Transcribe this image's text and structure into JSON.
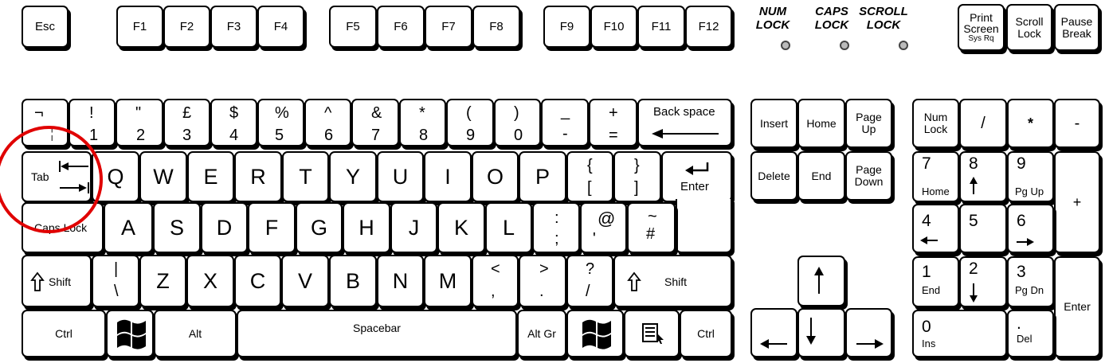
{
  "function_row": {
    "esc": "Esc",
    "f": [
      "F1",
      "F2",
      "F3",
      "F4",
      "F5",
      "F6",
      "F7",
      "F8",
      "F9",
      "F10",
      "F11",
      "F12"
    ]
  },
  "lock_lights": {
    "num": [
      "NUM",
      "LOCK"
    ],
    "caps": [
      "CAPS",
      "LOCK"
    ],
    "scroll": [
      "SCROLL",
      "LOCK"
    ]
  },
  "system_keys": {
    "print": [
      "Print",
      "Screen",
      "Sys Rq"
    ],
    "scroll": [
      "Scroll",
      "Lock"
    ],
    "pause": [
      "Pause",
      "Break"
    ]
  },
  "number_row": [
    {
      "top": "¬",
      "bot": "¦"
    },
    {
      "top": "!",
      "bot": "1"
    },
    {
      "top": "\"",
      "bot": "2"
    },
    {
      "top": "£",
      "bot": "3"
    },
    {
      "top": "$",
      "bot": "4"
    },
    {
      "top": "%",
      "bot": "5"
    },
    {
      "top": "^",
      "bot": "6"
    },
    {
      "top": "&",
      "bot": "7"
    },
    {
      "top": "*",
      "bot": "8"
    },
    {
      "top": "(",
      "bot": "9"
    },
    {
      "top": ")",
      "bot": "0"
    },
    {
      "top": "_",
      "bot": "-"
    },
    {
      "top": "+",
      "bot": "="
    }
  ],
  "backspace": "Back space",
  "tab": "Tab",
  "qwerty": [
    "Q",
    "W",
    "E",
    "R",
    "T",
    "Y",
    "U",
    "I",
    "O",
    "P"
  ],
  "brackets": [
    {
      "top": "{",
      "bot": "["
    },
    {
      "top": "}",
      "bot": "]"
    }
  ],
  "enter": "Enter",
  "caps_lock": "Caps Lock",
  "asdf": [
    "A",
    "S",
    "D",
    "F",
    "G",
    "H",
    "J",
    "K",
    "L"
  ],
  "home_punct": [
    {
      "top": ":",
      "bot": ";"
    },
    {
      "top": "@",
      "bot": "'"
    },
    {
      "top": "~",
      "bot": "#"
    }
  ],
  "shift": "Shift",
  "backslash": {
    "top": "|",
    "bot": "\\"
  },
  "zxcv": [
    "Z",
    "X",
    "C",
    "V",
    "B",
    "N",
    "M"
  ],
  "bottom_punct": [
    {
      "top": "<",
      "bot": ","
    },
    {
      "top": ">",
      "bot": "."
    },
    {
      "top": "?",
      "bot": "/"
    }
  ],
  "ctrl": "Ctrl",
  "alt": "Alt",
  "spacebar": "Spacebar",
  "alt_gr": "Alt Gr",
  "nav": {
    "insert": "Insert",
    "home": "Home",
    "page_up": [
      "Page",
      "Up"
    ],
    "delete": "Delete",
    "end": "End",
    "page_down": [
      "Page",
      "Down"
    ]
  },
  "numpad": {
    "num_lock": [
      "Num",
      "Lock"
    ],
    "divide": "/",
    "multiply": "*",
    "minus": "-",
    "plus": "+",
    "enter": "Enter",
    "k7": [
      "7",
      "Home"
    ],
    "k8": "8",
    "k9": [
      "9",
      "Pg Up"
    ],
    "k4": "4",
    "k5": "5",
    "k6": "6",
    "k1": [
      "1",
      "End"
    ],
    "k2": "2",
    "k3": [
      "3",
      "Pg Dn"
    ],
    "k0": [
      "0",
      "Ins"
    ],
    "kdot": [
      ".",
      "Del"
    ]
  },
  "colors": {
    "highlight_circle": "#e00000",
    "key_outline": "#000000",
    "key_fill": "#ffffff"
  }
}
